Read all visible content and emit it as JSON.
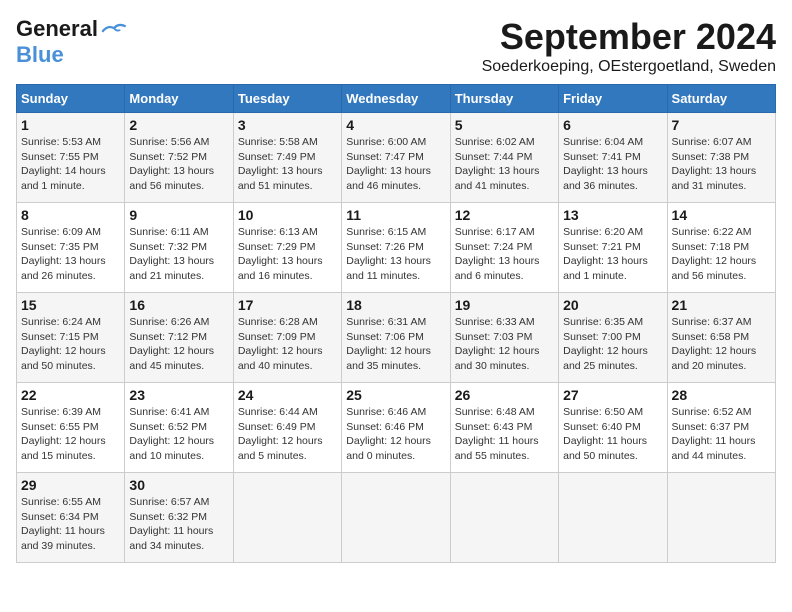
{
  "logo": {
    "line1": "General",
    "line2": "Blue"
  },
  "title": "September 2024",
  "location": "Soederkoeping, OEstergoetland, Sweden",
  "headers": [
    "Sunday",
    "Monday",
    "Tuesday",
    "Wednesday",
    "Thursday",
    "Friday",
    "Saturday"
  ],
  "weeks": [
    [
      {
        "day": 1,
        "sunrise": "5:53 AM",
        "sunset": "7:55 PM",
        "daylight": "14 hours and 1 minute."
      },
      {
        "day": 2,
        "sunrise": "5:56 AM",
        "sunset": "7:52 PM",
        "daylight": "13 hours and 56 minutes."
      },
      {
        "day": 3,
        "sunrise": "5:58 AM",
        "sunset": "7:49 PM",
        "daylight": "13 hours and 51 minutes."
      },
      {
        "day": 4,
        "sunrise": "6:00 AM",
        "sunset": "7:47 PM",
        "daylight": "13 hours and 46 minutes."
      },
      {
        "day": 5,
        "sunrise": "6:02 AM",
        "sunset": "7:44 PM",
        "daylight": "13 hours and 41 minutes."
      },
      {
        "day": 6,
        "sunrise": "6:04 AM",
        "sunset": "7:41 PM",
        "daylight": "13 hours and 36 minutes."
      },
      {
        "day": 7,
        "sunrise": "6:07 AM",
        "sunset": "7:38 PM",
        "daylight": "13 hours and 31 minutes."
      }
    ],
    [
      {
        "day": 8,
        "sunrise": "6:09 AM",
        "sunset": "7:35 PM",
        "daylight": "13 hours and 26 minutes."
      },
      {
        "day": 9,
        "sunrise": "6:11 AM",
        "sunset": "7:32 PM",
        "daylight": "13 hours and 21 minutes."
      },
      {
        "day": 10,
        "sunrise": "6:13 AM",
        "sunset": "7:29 PM",
        "daylight": "13 hours and 16 minutes."
      },
      {
        "day": 11,
        "sunrise": "6:15 AM",
        "sunset": "7:26 PM",
        "daylight": "13 hours and 11 minutes."
      },
      {
        "day": 12,
        "sunrise": "6:17 AM",
        "sunset": "7:24 PM",
        "daylight": "13 hours and 6 minutes."
      },
      {
        "day": 13,
        "sunrise": "6:20 AM",
        "sunset": "7:21 PM",
        "daylight": "13 hours and 1 minute."
      },
      {
        "day": 14,
        "sunrise": "6:22 AM",
        "sunset": "7:18 PM",
        "daylight": "12 hours and 56 minutes."
      }
    ],
    [
      {
        "day": 15,
        "sunrise": "6:24 AM",
        "sunset": "7:15 PM",
        "daylight": "12 hours and 50 minutes."
      },
      {
        "day": 16,
        "sunrise": "6:26 AM",
        "sunset": "7:12 PM",
        "daylight": "12 hours and 45 minutes."
      },
      {
        "day": 17,
        "sunrise": "6:28 AM",
        "sunset": "7:09 PM",
        "daylight": "12 hours and 40 minutes."
      },
      {
        "day": 18,
        "sunrise": "6:31 AM",
        "sunset": "7:06 PM",
        "daylight": "12 hours and 35 minutes."
      },
      {
        "day": 19,
        "sunrise": "6:33 AM",
        "sunset": "7:03 PM",
        "daylight": "12 hours and 30 minutes."
      },
      {
        "day": 20,
        "sunrise": "6:35 AM",
        "sunset": "7:00 PM",
        "daylight": "12 hours and 25 minutes."
      },
      {
        "day": 21,
        "sunrise": "6:37 AM",
        "sunset": "6:58 PM",
        "daylight": "12 hours and 20 minutes."
      }
    ],
    [
      {
        "day": 22,
        "sunrise": "6:39 AM",
        "sunset": "6:55 PM",
        "daylight": "12 hours and 15 minutes."
      },
      {
        "day": 23,
        "sunrise": "6:41 AM",
        "sunset": "6:52 PM",
        "daylight": "12 hours and 10 minutes."
      },
      {
        "day": 24,
        "sunrise": "6:44 AM",
        "sunset": "6:49 PM",
        "daylight": "12 hours and 5 minutes."
      },
      {
        "day": 25,
        "sunrise": "6:46 AM",
        "sunset": "6:46 PM",
        "daylight": "12 hours and 0 minutes."
      },
      {
        "day": 26,
        "sunrise": "6:48 AM",
        "sunset": "6:43 PM",
        "daylight": "11 hours and 55 minutes."
      },
      {
        "day": 27,
        "sunrise": "6:50 AM",
        "sunset": "6:40 PM",
        "daylight": "11 hours and 50 minutes."
      },
      {
        "day": 28,
        "sunrise": "6:52 AM",
        "sunset": "6:37 PM",
        "daylight": "11 hours and 44 minutes."
      }
    ],
    [
      {
        "day": 29,
        "sunrise": "6:55 AM",
        "sunset": "6:34 PM",
        "daylight": "11 hours and 39 minutes."
      },
      {
        "day": 30,
        "sunrise": "6:57 AM",
        "sunset": "6:32 PM",
        "daylight": "11 hours and 34 minutes."
      },
      null,
      null,
      null,
      null,
      null
    ]
  ]
}
